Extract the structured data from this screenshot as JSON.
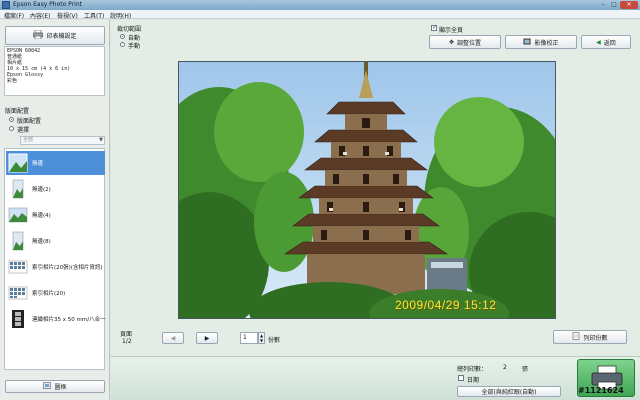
{
  "window": {
    "title": "Epson Easy Photo Print",
    "min": "–",
    "max": "□",
    "close": "✕"
  },
  "menu": [
    {
      "label": "檔案(F)"
    },
    {
      "label": "內容(E)"
    },
    {
      "label": "檢視(V)"
    },
    {
      "label": "工具(T)"
    },
    {
      "label": "說明(H)"
    }
  ],
  "sidebar": {
    "paper_settings_label": "印表機設定",
    "paper_info": "EPSON 60042\n普通紙\n相片紙\n10 x 15 cm (4 x 6 in)\nEpson Glossy\n彩色",
    "layout_section_label": "版面配置",
    "layout_mode_options": [
      {
        "label": "版面配置",
        "selected": true
      },
      {
        "label": "選擇",
        "selected": false
      }
    ],
    "layout_select_value": "全部",
    "layouts": [
      {
        "label": "無邊",
        "selected": true
      },
      {
        "label": "無邊(2)",
        "selected": false
      },
      {
        "label": "無邊(4)",
        "selected": false
      },
      {
        "label": "無邊(8)",
        "selected": false
      },
      {
        "label": "索引相片(20張)(含相片資訊)",
        "selected": false
      },
      {
        "label": "索引相片(20)",
        "selected": false
      },
      {
        "label": "連續相片35 x 50 mm/八合一",
        "selected": false
      }
    ],
    "bottom_button_label": "圖框"
  },
  "main": {
    "cut_label": "裁切範圍",
    "cut_options": [
      {
        "label": "自動",
        "selected": true
      },
      {
        "label": "手動",
        "selected": false
      }
    ],
    "show_all_label": "顯示全頁",
    "show_all_checked": true,
    "adjust_position_label": "調整位置",
    "image_correction_label": "影像校正",
    "back_label": "返回",
    "photo_date_stamp": "2009/04/29 15:12",
    "page_label": "頁面",
    "page_value": "1/2",
    "copies_value": "1",
    "copies_unit": "份數",
    "print_multiple_label": "列印份數"
  },
  "bottom": {
    "total_label": "總列印數：",
    "total_value": "2",
    "total_unit": "張",
    "date_label": "日期",
    "date_checked": false,
    "auto_button_label": "全部(與純紅眼(自動)"
  },
  "watermark": "#1121624",
  "colors": {
    "accent": "#4d8fd8",
    "print_green": "#3ea654",
    "date_stamp": "#f5ea3a"
  }
}
